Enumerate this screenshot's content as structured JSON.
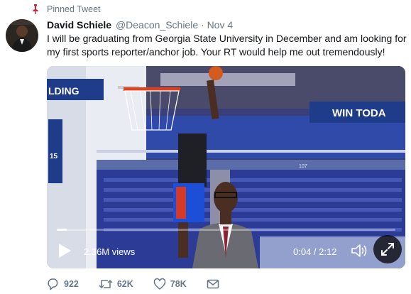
{
  "pinned": {
    "label": "Pinned Tweet",
    "icon": "pin-icon"
  },
  "author": {
    "name": "David Schiele",
    "handle": "@Deacon_Schiele",
    "separator": "·",
    "date": "Nov 4"
  },
  "tweet": {
    "text": "I will be graduating from Georgia State University in December and am looking for my first sports reporter/anchor job. Your RT would help me out tremendously!"
  },
  "video": {
    "views": "2.36M views",
    "time": "0:04 / 2:12",
    "progress": 0.03,
    "scene_text": {
      "banner": "WIN TODA",
      "sign": "LDING",
      "pillar": "15",
      "section": "107"
    }
  },
  "actions": {
    "reply": {
      "icon": "reply-icon",
      "count": "922"
    },
    "retweet": {
      "icon": "retweet-icon",
      "count": "62K"
    },
    "like": {
      "icon": "heart-icon",
      "count": "78K"
    },
    "message": {
      "icon": "envelope-icon"
    }
  },
  "colors": {
    "pin": "#e0245e",
    "muted": "#657786",
    "text": "#14171a"
  }
}
